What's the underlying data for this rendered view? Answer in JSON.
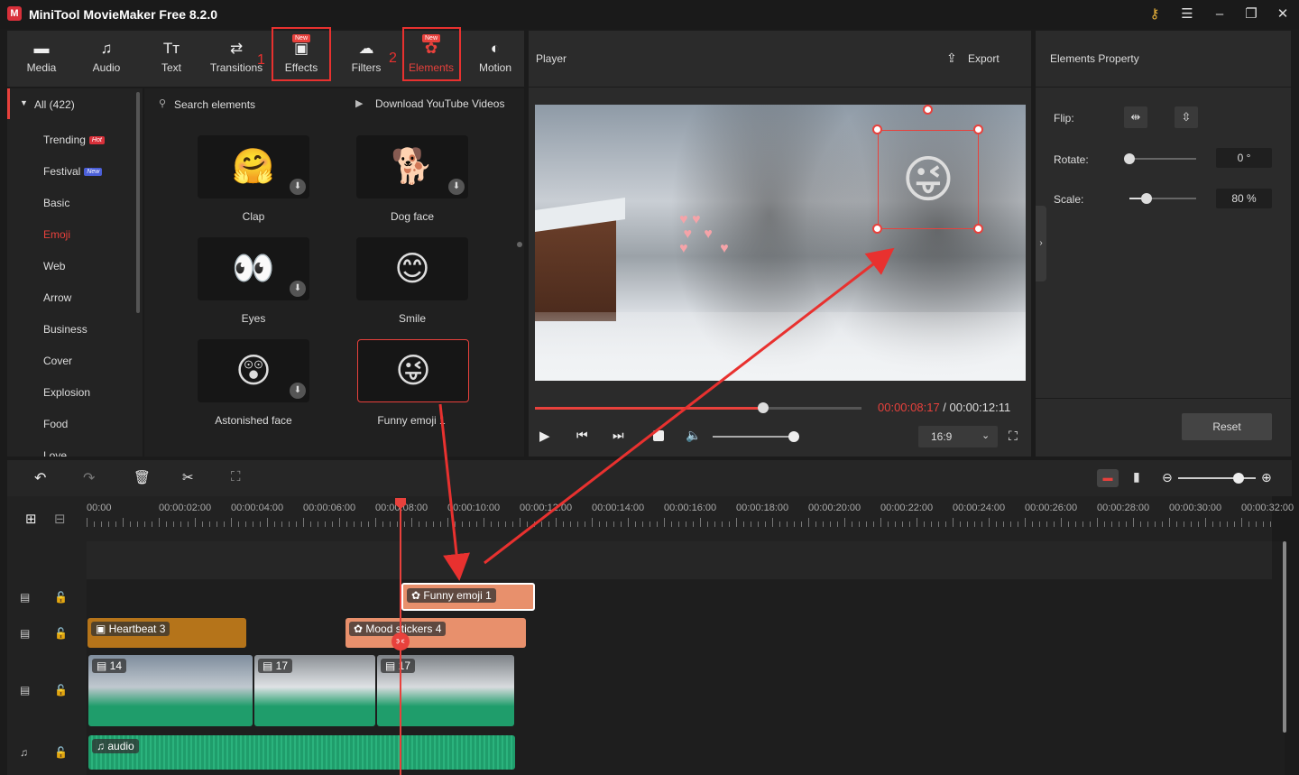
{
  "app": {
    "title": "MiniTool MovieMaker Free 8.2.0",
    "logo": "M"
  },
  "toolbar": {
    "items": [
      {
        "label": "Media",
        "icon": "folder-icon"
      },
      {
        "label": "Audio",
        "icon": "music-note-icon"
      },
      {
        "label": "Text",
        "icon": "text-icon"
      },
      {
        "label": "Transitions",
        "icon": "transitions-icon"
      },
      {
        "label": "Effects",
        "icon": "effects-icon",
        "badge": "New"
      },
      {
        "label": "Filters",
        "icon": "filters-icon"
      },
      {
        "label": "Elements",
        "icon": "elements-icon",
        "badge": "New"
      },
      {
        "label": "Motion",
        "icon": "motion-icon"
      }
    ],
    "annotation_numbers": [
      "1",
      "2",
      "3"
    ]
  },
  "categories": {
    "all": "All (422)",
    "items": [
      {
        "label": "Trending",
        "badge": "Hot"
      },
      {
        "label": "Festival",
        "badge": "New"
      },
      {
        "label": "Basic"
      },
      {
        "label": "Emoji",
        "active": true
      },
      {
        "label": "Web"
      },
      {
        "label": "Arrow"
      },
      {
        "label": "Business"
      },
      {
        "label": "Cover"
      },
      {
        "label": "Explosion"
      },
      {
        "label": "Food"
      },
      {
        "label": "Love"
      }
    ]
  },
  "elements": {
    "search_placeholder": "Search elements",
    "download_link": "Download YouTube Videos",
    "tiles": [
      {
        "label": "Clap",
        "emoji": "🤗"
      },
      {
        "label": "Dog face",
        "emoji": "🐕"
      },
      {
        "label": "Eyes",
        "emoji": "👀"
      },
      {
        "label": "Smile",
        "emoji": "😊"
      },
      {
        "label": "Astonished face",
        "emoji": "😲"
      },
      {
        "label": "Funny emoji 1",
        "emoji": "😜"
      }
    ]
  },
  "player": {
    "title": "Player",
    "export_label": "Export",
    "current_time": "00:00:08:17",
    "separator": " / ",
    "total_time": "00:00:12:11",
    "progress": 0.7,
    "volume": 0.95,
    "aspect_ratio": "16:9"
  },
  "properties": {
    "title": "Elements Property",
    "flip_label": "Flip:",
    "rotate_label": "Rotate:",
    "rotate_value": "0 °",
    "rotate_level": 0.0,
    "scale_label": "Scale:",
    "scale_value": "80 %",
    "scale_level": 0.25,
    "reset_label": "Reset"
  },
  "timeline": {
    "ticks": [
      "00:00",
      "00:00:02:00",
      "00:00:04:00",
      "00:00:06:00",
      "00:00:08:00",
      "00:00:10:00",
      "00:00:12:00",
      "00:00:14:00",
      "00:00:16:00",
      "00:00:18:00",
      "00:00:20:00",
      "00:00:22:00",
      "00:00:24:00",
      "00:00:26:00",
      "00:00:28:00",
      "00:00:30:00",
      "00:00:32:00"
    ],
    "zoom_level": 0.78,
    "clips": {
      "funny_emoji": "Funny emoji 1",
      "heartbeat": "Heartbeat 3",
      "mood_stickers": "Mood stickers 4",
      "video1": "14",
      "video2": "17",
      "video3": "17",
      "audio": "audio"
    }
  },
  "colors": {
    "accent": "#e8413c",
    "sticker_clip": "#e8906c",
    "heartbeat_clip": "#b5741a",
    "audio_clip": "#1f9d6b",
    "playhead": "#e8413c"
  }
}
